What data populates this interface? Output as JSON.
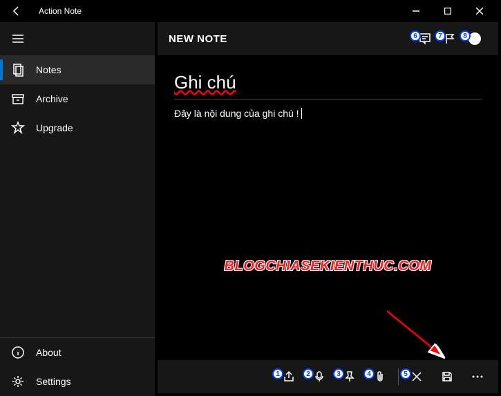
{
  "titlebar": {
    "appName": "Action Note"
  },
  "sidebar": {
    "notes": "Notes",
    "archive": "Archive",
    "upgrade": "Upgrade",
    "about": "About",
    "settings": "Settings"
  },
  "header": {
    "title": "NEW NOTE",
    "badge6": "6",
    "badge7": "7",
    "badge8": "8"
  },
  "note": {
    "title": "Ghi chú",
    "content": "Đây là nội dung của ghi chú !"
  },
  "watermark": "BLOGCHIASEKIENTHUC.COM",
  "bottomBar": {
    "badge1": "1",
    "badge2": "2",
    "badge3": "3",
    "badge4": "4",
    "badge5": "5"
  }
}
